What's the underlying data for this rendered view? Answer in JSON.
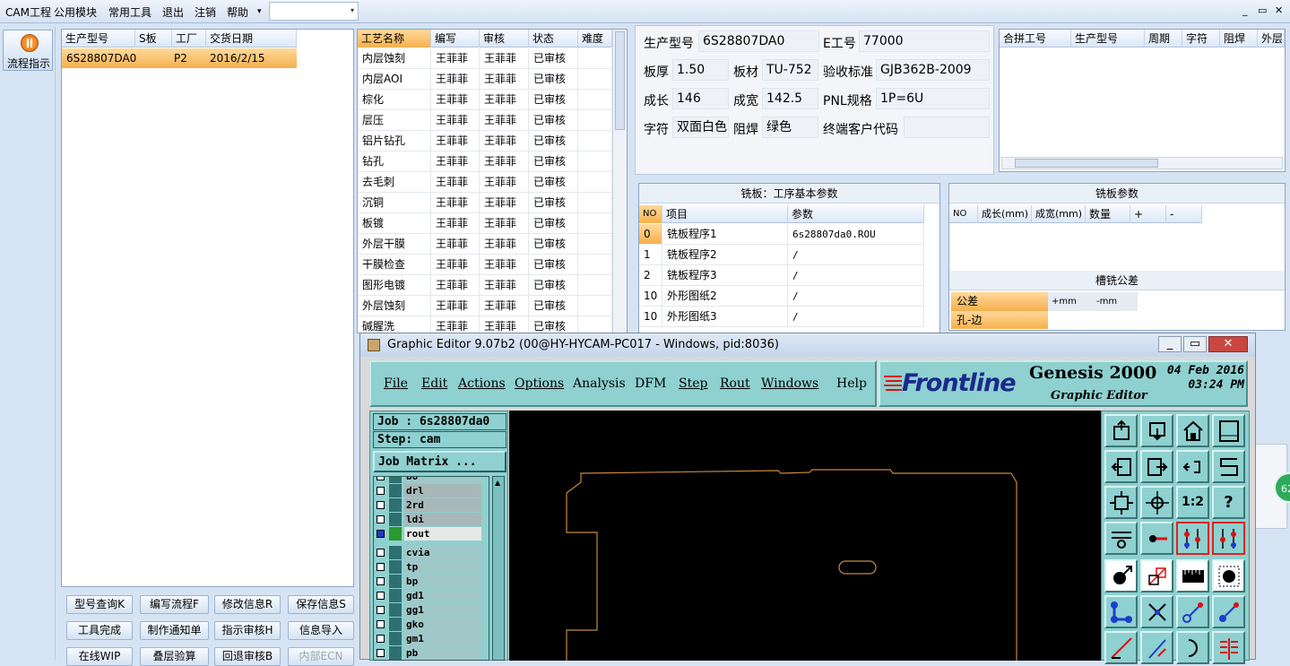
{
  "menu": {
    "items": [
      "CAM工程",
      "公用模块",
      "常用工具",
      "退出",
      "注销",
      "帮助"
    ],
    "combo_arrow": "▾"
  },
  "window_controls": {
    "min": "_",
    "restore": "▭",
    "close": "✕"
  },
  "left": {
    "flow_button": "流程指示"
  },
  "jobs": {
    "columns": [
      "生产型号",
      "S板",
      "工厂",
      "交货日期"
    ],
    "rows": [
      [
        "6S28807DA0",
        "",
        "P2",
        "2016/2/15"
      ]
    ]
  },
  "buttons": [
    [
      "型号查询K",
      "编写流程F",
      "修改信息R",
      "保存信息S"
    ],
    [
      "工具完成",
      "制作通知单",
      "指示审核H",
      "信息导入"
    ],
    [
      "在线WIP",
      "叠层验算",
      "回退审核B",
      "内部ECN"
    ]
  ],
  "process": {
    "columns": [
      "工艺名称",
      "编写",
      "审核",
      "状态",
      "难度"
    ],
    "rows": [
      [
        "内层蚀刻",
        "王菲菲",
        "王菲菲",
        "已审核",
        ""
      ],
      [
        "内层AOI",
        "王菲菲",
        "王菲菲",
        "已审核",
        ""
      ],
      [
        "棕化",
        "王菲菲",
        "王菲菲",
        "已审核",
        ""
      ],
      [
        "层压",
        "王菲菲",
        "王菲菲",
        "已审核",
        ""
      ],
      [
        "铝片钻孔",
        "王菲菲",
        "王菲菲",
        "已审核",
        ""
      ],
      [
        "钻孔",
        "王菲菲",
        "王菲菲",
        "已审核",
        ""
      ],
      [
        "去毛刺",
        "王菲菲",
        "王菲菲",
        "已审核",
        ""
      ],
      [
        "沉铜",
        "王菲菲",
        "王菲菲",
        "已审核",
        ""
      ],
      [
        "板镀",
        "王菲菲",
        "王菲菲",
        "已审核",
        ""
      ],
      [
        "外层干膜",
        "王菲菲",
        "王菲菲",
        "已审核",
        ""
      ],
      [
        "干膜检查",
        "王菲菲",
        "王菲菲",
        "已审核",
        ""
      ],
      [
        "图形电镀",
        "王菲菲",
        "王菲菲",
        "已审核",
        ""
      ],
      [
        "外层蚀刻",
        "王菲菲",
        "王菲菲",
        "已审核",
        ""
      ],
      [
        "碱腥洗",
        "王菲菲",
        "王菲菲",
        "已审核",
        ""
      ]
    ]
  },
  "info": {
    "model_label": "生产型号",
    "model": "6S28807DA0",
    "eno_label": "E工号",
    "eno": "77000",
    "thick_label": "板厚",
    "thick": "1.50",
    "mat_label": "板材",
    "mat": "TU-752",
    "std_label": "验收标准",
    "std": "GJB362B-2009",
    "len_label": "成长",
    "len": "146",
    "wid_label": "成宽",
    "wid": "142.5",
    "pnl_label": "PNL规格",
    "pnl": "1P=6U",
    "silk_label": "字符",
    "silk": "双面白色",
    "mask_label": "阻焊",
    "mask": "绿色",
    "cust_label": "终端客户代码",
    "cust": ""
  },
  "combine": {
    "columns": [
      "合拼工号",
      "生产型号",
      "周期",
      "字符",
      "阻焊",
      "外层"
    ]
  },
  "mill": {
    "title": "铣板：工序基本参数",
    "columns": [
      "NO",
      "项目",
      "参数"
    ],
    "rows": [
      [
        "0",
        "铣板程序1",
        "6s28807da0.ROU"
      ],
      [
        "1",
        "铣板程序2",
        "/"
      ],
      [
        "2",
        "铣板程序3",
        "/"
      ],
      [
        "10",
        "外形图纸2",
        "/"
      ],
      [
        "10",
        "外形图纸3",
        "/"
      ]
    ]
  },
  "millparam": {
    "title": "铣板参数",
    "columns": [
      "NO",
      "成长(mm)",
      "成宽(mm)",
      "数量",
      "+",
      "-"
    ]
  },
  "slot": {
    "title": "槽铣公差",
    "tol_label": "公差",
    "plus": "+mm",
    "minus": "-mm",
    "row1": "孔-边"
  },
  "badge": "62",
  "ge": {
    "title": "Graphic Editor 9.07b2 (00@HY-HYCAM-PC017 - Windows, pid:8036)",
    "menu": [
      "File",
      "Edit",
      "Actions",
      "Options",
      "Analysis",
      "DFM",
      "Step",
      "Rout",
      "Windows",
      "Help"
    ],
    "brand": "Frontline",
    "product": "Genesis 2000",
    "subtitle": "Graphic Editor",
    "date": "04 Feb 2016",
    "time": "03:24 PM",
    "job": "Job : 6s28807da0",
    "step": "Step: cam",
    "matrix": "Job Matrix ...",
    "layers": [
      "bo",
      "drl",
      "2rd",
      "ldi",
      "rout",
      "cvia",
      "tp",
      "bp",
      "gd1",
      "gg1",
      "gko",
      "gm1",
      "pb"
    ],
    "ratio": "1:2",
    "help": "?"
  },
  "colors": {
    "accent": "#f6b04d",
    "teal": "#8fd0d0",
    "outline": "#c8893c"
  }
}
